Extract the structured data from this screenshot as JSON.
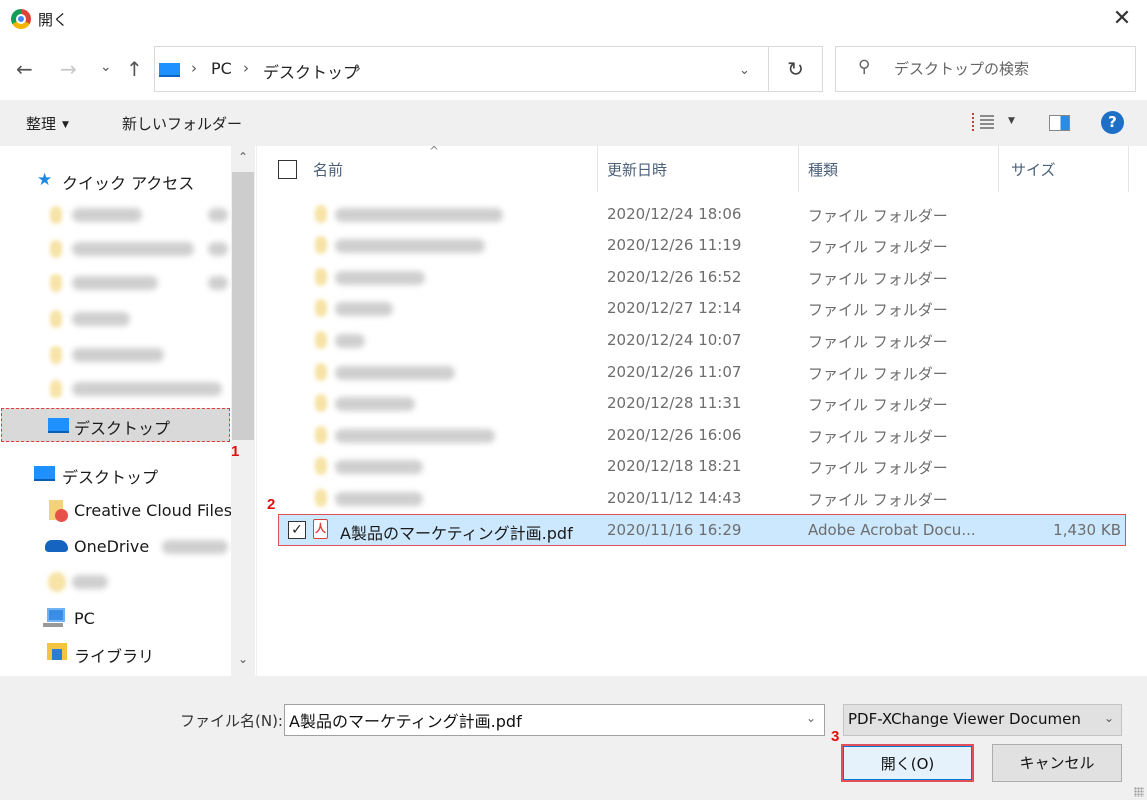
{
  "window": {
    "title": "開く",
    "close_icon": "close-icon"
  },
  "nav": {
    "back_icon": "←",
    "forward_icon": "→",
    "recent_icon": "⌄",
    "up_icon": "↑",
    "breadcrumb": [
      "PC",
      "デスクトップ"
    ],
    "crumb_sep": "›",
    "dropdown_icon": "⌄",
    "refresh_icon": "↻",
    "search_placeholder": "デスクトップの検索",
    "search_icon": "⚲"
  },
  "toolbar": {
    "organize_label": "整理",
    "organize_caret": "▼",
    "new_folder_label": "新しいフォルダー",
    "view_caret": "▼",
    "help_label": "?"
  },
  "sidebar": {
    "quick_access_label": "クイック アクセス",
    "quick_access_icon": "★",
    "selected_item_label": "デスクトップ",
    "desktop_label": "デスクトップ",
    "creative_cloud_label": "Creative Cloud Files",
    "onedrive_label": "OneDrive",
    "pc_label": "PC",
    "library_label": "ライブラリ",
    "scroll_up": "⌃",
    "scroll_down": "⌄"
  },
  "filelist": {
    "columns": [
      "名前",
      "更新日時",
      "種類",
      "サイズ"
    ],
    "sort_caret": "^",
    "folders": [
      {
        "date": "2020/12/24 18:06",
        "type": "ファイル フォルダー"
      },
      {
        "date": "2020/12/26 11:19",
        "type": "ファイル フォルダー"
      },
      {
        "date": "2020/12/26 16:52",
        "type": "ファイル フォルダー"
      },
      {
        "date": "2020/12/27 12:14",
        "type": "ファイル フォルダー"
      },
      {
        "date": "2020/12/24 10:07",
        "type": "ファイル フォルダー"
      },
      {
        "date": "2020/12/26 11:07",
        "type": "ファイル フォルダー"
      },
      {
        "date": "2020/12/28 11:31",
        "type": "ファイル フォルダー"
      },
      {
        "date": "2020/12/26 16:06",
        "type": "ファイル フォルダー"
      },
      {
        "date": "2020/12/18 18:21",
        "type": "ファイル フォルダー"
      },
      {
        "date": "2020/11/12 14:43",
        "type": "ファイル フォルダー"
      }
    ],
    "selected_file": {
      "name": "A製品のマーケティング計画.pdf",
      "date": "2020/11/16 16:29",
      "type": "Adobe Acrobat Docu...",
      "size": "1,430 KB",
      "checked": "✓",
      "pdf_glyph": "人"
    }
  },
  "annotations": [
    "1",
    "2",
    "3"
  ],
  "footer": {
    "filename_label": "ファイル名(N):",
    "filename_value": "A製品のマーケティング計画.pdf",
    "filename_dropdown": "⌄",
    "filetype_value": "PDF-XChange Viewer Documen",
    "filetype_caret": "⌄",
    "open_label": "開く(O)",
    "cancel_label": "キャンセル"
  }
}
